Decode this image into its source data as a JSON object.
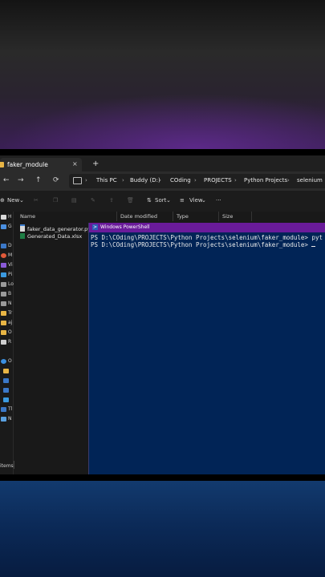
{
  "explorer": {
    "tab_title": "faker_module",
    "tab_close": "×",
    "new_tab": "+",
    "nav": {
      "back": "←",
      "forward": "→",
      "up": "↑",
      "refresh": "⟳"
    },
    "breadcrumbs": [
      "This PC",
      "Buddy (D:)",
      "COding",
      "PROJECTS",
      "Python Projects",
      "selenium"
    ],
    "crumb_separator": "›",
    "toolbar": {
      "new_label": "New",
      "sort_label": "Sort",
      "view_label": "View",
      "more_label": "···"
    },
    "columns": [
      "Name",
      "Date modified",
      "Type",
      "Size"
    ],
    "files": [
      {
        "name": "faker_data_generator.py",
        "icon": "python-file-icon"
      },
      {
        "name": "Generated_Data.xlsx",
        "icon": "excel-file-icon"
      }
    ],
    "sidebar_labels": [
      "H",
      "G",
      "D",
      "M",
      "Vi",
      "Pi",
      "Lo",
      "B",
      "N",
      "Tr",
      "aj",
      "O",
      "R",
      "O",
      "Tl",
      "N"
    ],
    "status_text": "items"
  },
  "powershell": {
    "title": "Windows PowerShell",
    "icon_glyph": ">",
    "lines": [
      "PS D:\\COding\\PROJECTS\\Python Projects\\selenium\\faker_module> pyt",
      "PS D:\\COding\\PROJECTS\\Python Projects\\selenium\\faker_module> "
    ]
  },
  "colors": {
    "powershell_bg": "#012456",
    "powershell_titlebar": "#6a1b9a",
    "explorer_bg": "#191919",
    "folder": "#e8b545"
  }
}
